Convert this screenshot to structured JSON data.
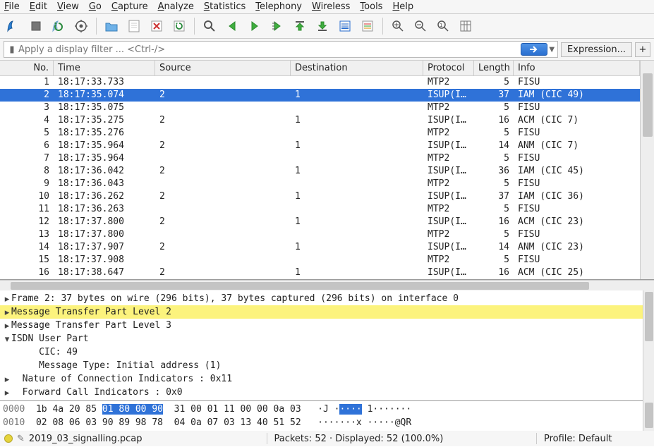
{
  "menu": [
    "File",
    "Edit",
    "View",
    "Go",
    "Capture",
    "Analyze",
    "Statistics",
    "Telephony",
    "Wireless",
    "Tools",
    "Help"
  ],
  "filter": {
    "placeholder": "Apply a display filter ... <Ctrl-/>",
    "expression_btn": "Expression...",
    "plus": "+"
  },
  "columns": [
    "No.",
    "Time",
    "Source",
    "Destination",
    "Protocol",
    "Length",
    "Info"
  ],
  "selected_row": 1,
  "packets": [
    {
      "no": "1",
      "time": "18:17:33.733",
      "src": "",
      "dst": "",
      "proto": "MTP2",
      "len": "5",
      "info": "FISU"
    },
    {
      "no": "2",
      "time": "18:17:35.074",
      "src": "2",
      "dst": "1",
      "proto": "ISUP(I…",
      "len": "37",
      "info": "IAM (CIC 49)"
    },
    {
      "no": "3",
      "time": "18:17:35.075",
      "src": "",
      "dst": "",
      "proto": "MTP2",
      "len": "5",
      "info": "FISU"
    },
    {
      "no": "4",
      "time": "18:17:35.275",
      "src": "2",
      "dst": "1",
      "proto": "ISUP(I…",
      "len": "16",
      "info": "ACM (CIC 7)"
    },
    {
      "no": "5",
      "time": "18:17:35.276",
      "src": "",
      "dst": "",
      "proto": "MTP2",
      "len": "5",
      "info": "FISU"
    },
    {
      "no": "6",
      "time": "18:17:35.964",
      "src": "2",
      "dst": "1",
      "proto": "ISUP(I…",
      "len": "14",
      "info": "ANM (CIC 7)"
    },
    {
      "no": "7",
      "time": "18:17:35.964",
      "src": "",
      "dst": "",
      "proto": "MTP2",
      "len": "5",
      "info": "FISU"
    },
    {
      "no": "8",
      "time": "18:17:36.042",
      "src": "2",
      "dst": "1",
      "proto": "ISUP(I…",
      "len": "36",
      "info": "IAM (CIC 45)"
    },
    {
      "no": "9",
      "time": "18:17:36.043",
      "src": "",
      "dst": "",
      "proto": "MTP2",
      "len": "5",
      "info": "FISU"
    },
    {
      "no": "10",
      "time": "18:17:36.262",
      "src": "2",
      "dst": "1",
      "proto": "ISUP(I…",
      "len": "37",
      "info": "IAM (CIC 36)"
    },
    {
      "no": "11",
      "time": "18:17:36.263",
      "src": "",
      "dst": "",
      "proto": "MTP2",
      "len": "5",
      "info": "FISU"
    },
    {
      "no": "12",
      "time": "18:17:37.800",
      "src": "2",
      "dst": "1",
      "proto": "ISUP(I…",
      "len": "16",
      "info": "ACM (CIC 23)"
    },
    {
      "no": "13",
      "time": "18:17:37.800",
      "src": "",
      "dst": "",
      "proto": "MTP2",
      "len": "5",
      "info": "FISU"
    },
    {
      "no": "14",
      "time": "18:17:37.907",
      "src": "2",
      "dst": "1",
      "proto": "ISUP(I…",
      "len": "14",
      "info": "ANM (CIC 23)"
    },
    {
      "no": "15",
      "time": "18:17:37.908",
      "src": "",
      "dst": "",
      "proto": "MTP2",
      "len": "5",
      "info": "FISU"
    },
    {
      "no": "16",
      "time": "18:17:38.647",
      "src": "2",
      "dst": "1",
      "proto": "ISUP(I…",
      "len": "16",
      "info": "ACM (CIC 25)"
    }
  ],
  "details": [
    {
      "tw": "▸",
      "indent": 0,
      "hl": false,
      "text": "Frame 2: 37 bytes on wire (296 bits), 37 bytes captured (296 bits) on interface 0"
    },
    {
      "tw": "▸",
      "indent": 0,
      "hl": true,
      "text": "Message Transfer Part Level 2"
    },
    {
      "tw": "▸",
      "indent": 0,
      "hl": false,
      "text": "Message Transfer Part Level 3"
    },
    {
      "tw": "▾",
      "indent": 0,
      "hl": false,
      "text": "ISDN User Part"
    },
    {
      "tw": "",
      "indent": 2,
      "hl": false,
      "text": "CIC: 49"
    },
    {
      "tw": "",
      "indent": 2,
      "hl": false,
      "text": "Message Type: Initial address (1)"
    },
    {
      "tw": "▸",
      "indent": 1,
      "hl": false,
      "text": "Nature of Connection Indicators : 0x11"
    },
    {
      "tw": "▸",
      "indent": 1,
      "hl": false,
      "text": "Forward Call Indicators : 0x0"
    }
  ],
  "hex": {
    "lines": [
      {
        "off": "0000",
        "b1": "1b 4a 20 85 ",
        "sel": "01 80 00 90",
        "b2": "  31 00 01 11 00 00 0a 03",
        "asc1": "   ·J ·",
        "asel": "····",
        "asc2": " 1·······"
      },
      {
        "off": "0010",
        "b1": "02 08 06 03 90 89 98 78  04 0a 07 03 13 40 51 52",
        "sel": "",
        "b2": "",
        "asc1": "   ·······x ·····@QR",
        "asel": "",
        "asc2": ""
      }
    ]
  },
  "status": {
    "file": "2019_03_signalling.pcap",
    "packets": "Packets: 52 · Displayed: 52 (100.0%)",
    "profile": "Profile: Default"
  }
}
